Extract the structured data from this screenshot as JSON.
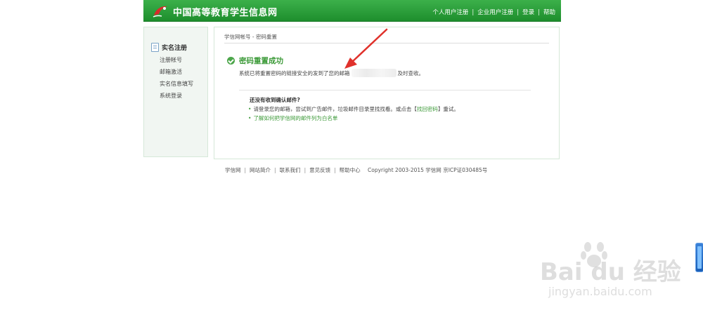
{
  "header": {
    "site_title": "中国高等教育学生信息网",
    "nav": [
      "个人用户注册",
      "企业用户注册",
      "登录",
      "帮助"
    ]
  },
  "sidebar": {
    "title": "实名注册",
    "items": [
      "注册帐号",
      "邮箱激活",
      "实名信息填写",
      "系统登录"
    ]
  },
  "main": {
    "breadcrumb": "学信网帐号 - 密码重置",
    "success_title": "密码重置成功",
    "desc_prefix": "系统已将重置密码的链接安全的发到了您的邮箱",
    "desc_suffix": "及时查收。",
    "help_title": "还没有收到确认邮件?",
    "help_line1_prefix": "请登录您的邮箱，尝试到广告邮件，垃圾邮件目录里找找看。或点击【",
    "help_line1_link": "找回密码",
    "help_line1_suffix": "】重试。",
    "help_line2": "了解如何把学信网的邮件列为白名单"
  },
  "footer": {
    "links": [
      "学信网",
      "网站简介",
      "联系我们",
      "意见反馈",
      "帮助中心"
    ],
    "copyright": "Copyright 2003-2015 学信网 京ICP证030485号"
  },
  "watermark": {
    "text": "Bai du 经验",
    "sub": "jingyan.baidu.com"
  },
  "colors": {
    "header_green": "#1e8e2d",
    "accent_green": "#3c9a38",
    "annotation_red": "#e0312b"
  }
}
